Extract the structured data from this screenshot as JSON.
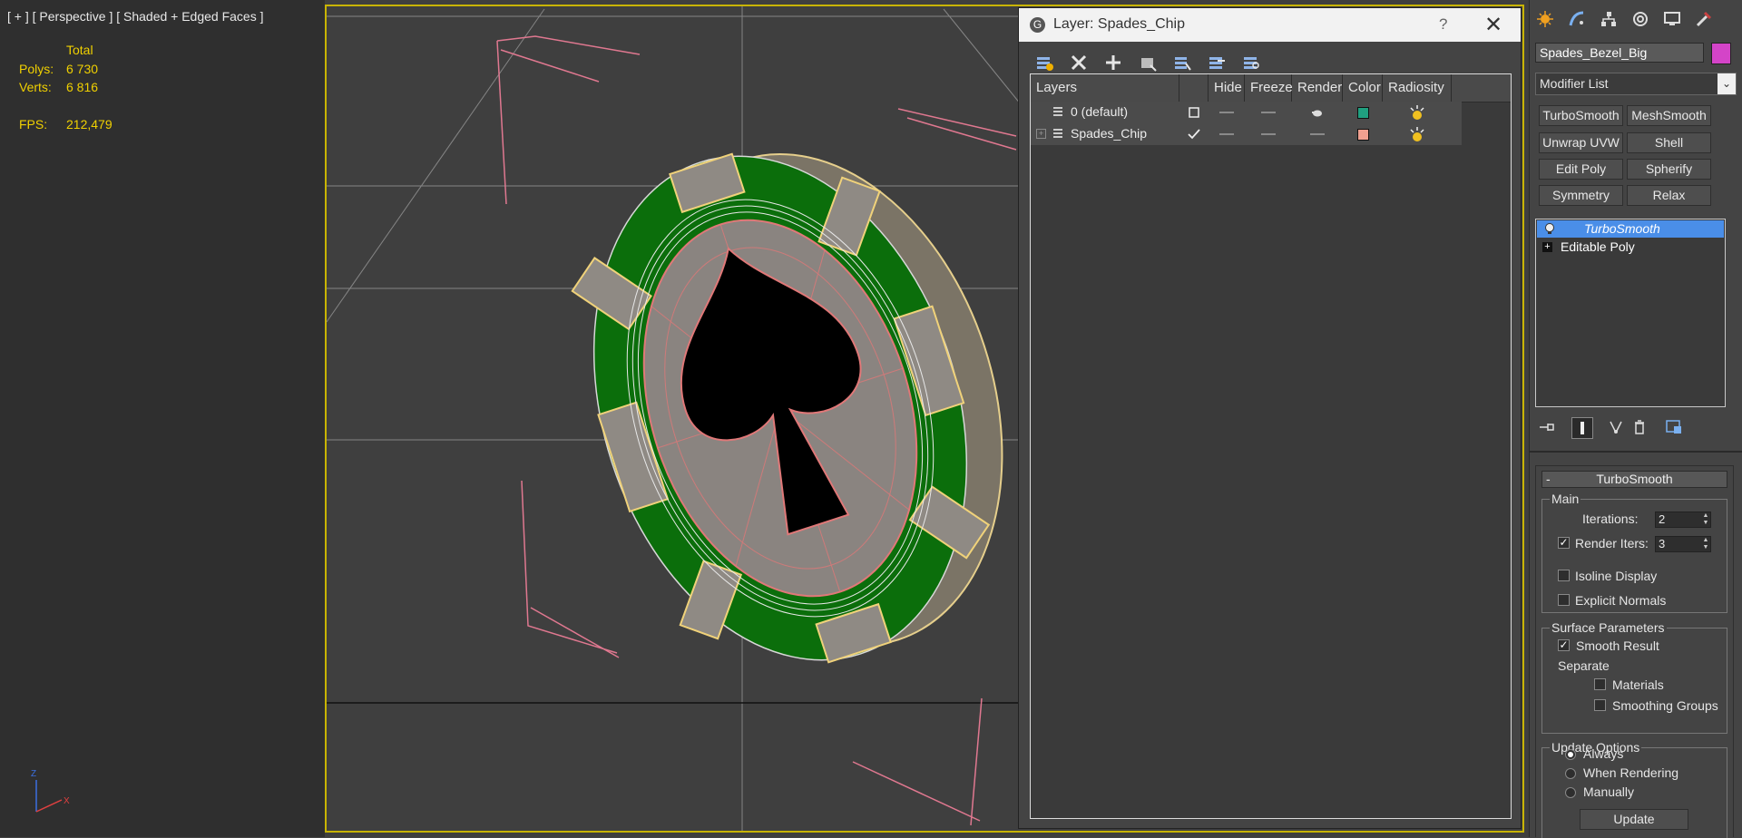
{
  "viewport": {
    "label": "[ + ] [ Perspective ] [ Shaded + Edged Faces ]",
    "stats": {
      "total_header": "Total",
      "polys_label": "Polys:",
      "polys_value": "6 730",
      "verts_label": "Verts:",
      "verts_value": "6 816",
      "fps_label": "FPS:",
      "fps_value": "212,479"
    },
    "axis_labels": {
      "z": "Z",
      "x": "X"
    },
    "colors": {
      "chip_green": "#0b6e0b",
      "chip_inlay": "#8f8a84",
      "spade": "#000000",
      "edge_yellow": "#f0d27a",
      "wire_pink": "#e07878"
    }
  },
  "layer_dialog": {
    "title": "Layer: Spades_Chip",
    "help": "?",
    "close": "✕",
    "toolbar_icons": [
      "create-layer-icon",
      "delete-layer-icon",
      "add-to-layer-icon",
      "select-objects-icon",
      "highlight-layer-icon",
      "hide-all-icon",
      "freeze-all-icon"
    ],
    "columns": {
      "layers": "Layers",
      "hide": "Hide",
      "freeze": "Freeze",
      "render": "Render",
      "color": "Color",
      "radiosity": "Radiosity"
    },
    "rows": [
      {
        "name": "0 (default)",
        "current": false,
        "color": "#20a080"
      },
      {
        "name": "Spades_Chip",
        "current": true,
        "color": "#f0a090"
      }
    ]
  },
  "command_panel": {
    "tab_icons": [
      "create-icon",
      "modify-icon",
      "hierarchy-icon",
      "motion-icon",
      "display-icon",
      "utilities-icon"
    ],
    "object_name": "Spades_Bezel_Big",
    "object_color": "#d444c8",
    "modifier_list": "Modifier List",
    "modifier_buttons": [
      "TurboSmooth",
      "MeshSmooth",
      "Unwrap UVW",
      "Shell",
      "Edit Poly",
      "Spherify",
      "Symmetry",
      "Relax"
    ],
    "stack": [
      {
        "label": "TurboSmooth",
        "selected": true
      },
      {
        "label": "Editable Poly",
        "selected": false
      }
    ],
    "rollout": {
      "title": "TurboSmooth",
      "main_group": "Main",
      "iterations_label": "Iterations:",
      "iterations_value": "2",
      "render_iters_label": "Render Iters:",
      "render_iters_value": "3",
      "render_iters_checked": true,
      "isoline_label": "Isoline Display",
      "isoline_checked": false,
      "explicit_normals_label": "Explicit Normals",
      "explicit_normals_checked": false,
      "surface_group": "Surface Parameters",
      "smooth_result_label": "Smooth Result",
      "smooth_result_checked": true,
      "separate_label": "Separate",
      "materials_label": "Materials",
      "materials_checked": false,
      "smoothing_groups_label": "Smoothing Groups",
      "smoothing_groups_checked": false,
      "update_group": "Update Options",
      "always_label": "Always",
      "when_rendering_label": "When Rendering",
      "manually_label": "Manually",
      "update_mode": "Always",
      "update_button": "Update"
    }
  }
}
